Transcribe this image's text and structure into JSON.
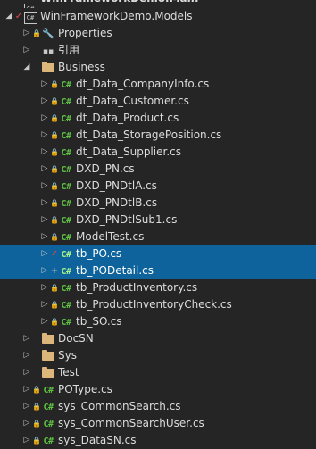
{
  "explorer": {
    "rows": [
      {
        "label": "WinFrameworkDemo.Main",
        "indent": 0,
        "arrow": "none",
        "status": "",
        "icon": "project",
        "topcut": true
      },
      {
        "label": "WinFrameworkDemo.Models",
        "indent": 0,
        "arrow": "down",
        "status": "check",
        "icon": "project"
      },
      {
        "label": "Properties",
        "indent": 1,
        "arrow": "right",
        "status": "lock",
        "icon": "wrench"
      },
      {
        "label": "引用",
        "indent": 1,
        "arrow": "right",
        "status": "",
        "icon": "refs"
      },
      {
        "label": "Business",
        "indent": 1,
        "arrow": "down",
        "status": "",
        "icon": "folder"
      },
      {
        "label": "dt_Data_CompanyInfo.cs",
        "indent": 2,
        "arrow": "right",
        "status": "lock",
        "icon": "cs"
      },
      {
        "label": "dt_Data_Customer.cs",
        "indent": 2,
        "arrow": "right",
        "status": "lock",
        "icon": "cs"
      },
      {
        "label": "dt_Data_Product.cs",
        "indent": 2,
        "arrow": "right",
        "status": "lock",
        "icon": "cs"
      },
      {
        "label": "dt_Data_StoragePosition.cs",
        "indent": 2,
        "arrow": "right",
        "status": "lock",
        "icon": "cs"
      },
      {
        "label": "dt_Data_Supplier.cs",
        "indent": 2,
        "arrow": "right",
        "status": "lock",
        "icon": "cs"
      },
      {
        "label": "DXD_PN.cs",
        "indent": 2,
        "arrow": "right",
        "status": "lock",
        "icon": "cs"
      },
      {
        "label": "DXD_PNDtlA.cs",
        "indent": 2,
        "arrow": "right",
        "status": "lock",
        "icon": "cs"
      },
      {
        "label": "DXD_PNDtlB.cs",
        "indent": 2,
        "arrow": "right",
        "status": "lock",
        "icon": "cs"
      },
      {
        "label": "DXD_PNDtlSub1.cs",
        "indent": 2,
        "arrow": "right",
        "status": "lock",
        "icon": "cs"
      },
      {
        "label": "ModelTest.cs",
        "indent": 2,
        "arrow": "right",
        "status": "lock",
        "icon": "cs"
      },
      {
        "label": "tb_PO.cs",
        "indent": 2,
        "arrow": "right",
        "status": "check",
        "icon": "cs",
        "selected": true
      },
      {
        "label": "tb_PODetail.cs",
        "indent": 2,
        "arrow": "right",
        "status": "plus",
        "icon": "cs",
        "selected": true
      },
      {
        "label": "tb_ProductInventory.cs",
        "indent": 2,
        "arrow": "right",
        "status": "lock",
        "icon": "cs"
      },
      {
        "label": "tb_ProductInventoryCheck.cs",
        "indent": 2,
        "arrow": "right",
        "status": "lock",
        "icon": "cs"
      },
      {
        "label": "tb_SO.cs",
        "indent": 2,
        "arrow": "right",
        "status": "lock",
        "icon": "cs"
      },
      {
        "label": "DocSN",
        "indent": 1,
        "arrow": "right",
        "status": "",
        "icon": "folder"
      },
      {
        "label": "Sys",
        "indent": 1,
        "arrow": "right",
        "status": "",
        "icon": "folder"
      },
      {
        "label": "Test",
        "indent": 1,
        "arrow": "right",
        "status": "",
        "icon": "folder"
      },
      {
        "label": "POType.cs",
        "indent": 1,
        "arrow": "right",
        "status": "lock",
        "icon": "cs"
      },
      {
        "label": "sys_CommonSearch.cs",
        "indent": 1,
        "arrow": "right",
        "status": "lock",
        "icon": "cs"
      },
      {
        "label": "sys_CommonSearchUser.cs",
        "indent": 1,
        "arrow": "right",
        "status": "lock",
        "icon": "cs"
      },
      {
        "label": "sys_DataSN.cs",
        "indent": 1,
        "arrow": "right",
        "status": "lock",
        "icon": "cs"
      }
    ]
  },
  "icon_text": {
    "cs": "C#",
    "project": "C#"
  },
  "colors": {
    "background": "#252526",
    "selection": "#0e639c",
    "lock": "#4aa3e6",
    "check": "#e04848",
    "cs": "#5ec442",
    "folder": "#dcb67a"
  }
}
